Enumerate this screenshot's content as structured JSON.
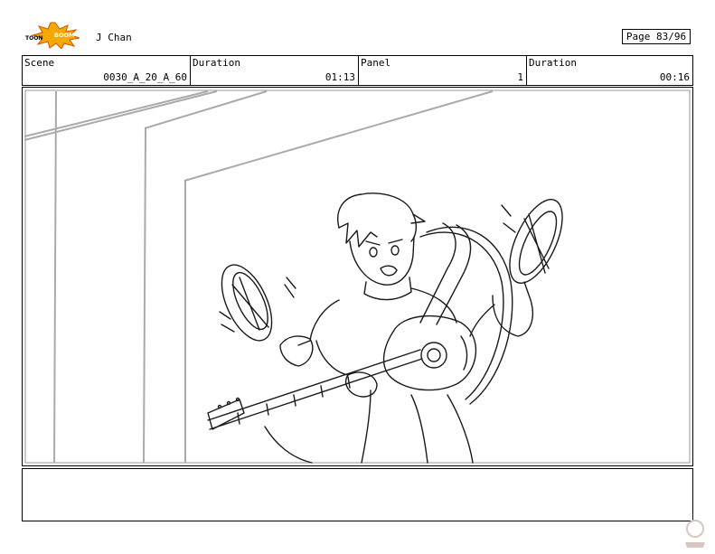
{
  "header": {
    "logo_text": "TOONBOOM",
    "show_title": "J Chan",
    "page_label": "Page 83/96"
  },
  "info": {
    "scene_label": "Scene",
    "scene_value": "0030_A_20_A_60",
    "duration_label": "Duration",
    "duration_value": "01:13",
    "panel_label": "Panel",
    "panel_value": "1",
    "duration2_label": "Duration",
    "duration2_value": "00:16"
  },
  "panel": {
    "description": "",
    "stroke_color": "#1a1a1a",
    "frame_color": "#999999"
  },
  "caption": {
    "text": ""
  },
  "colors": {
    "logo_burst": "#f5a800",
    "logo_burst_dark": "#d35400",
    "watermark": "#d9c6c0"
  }
}
